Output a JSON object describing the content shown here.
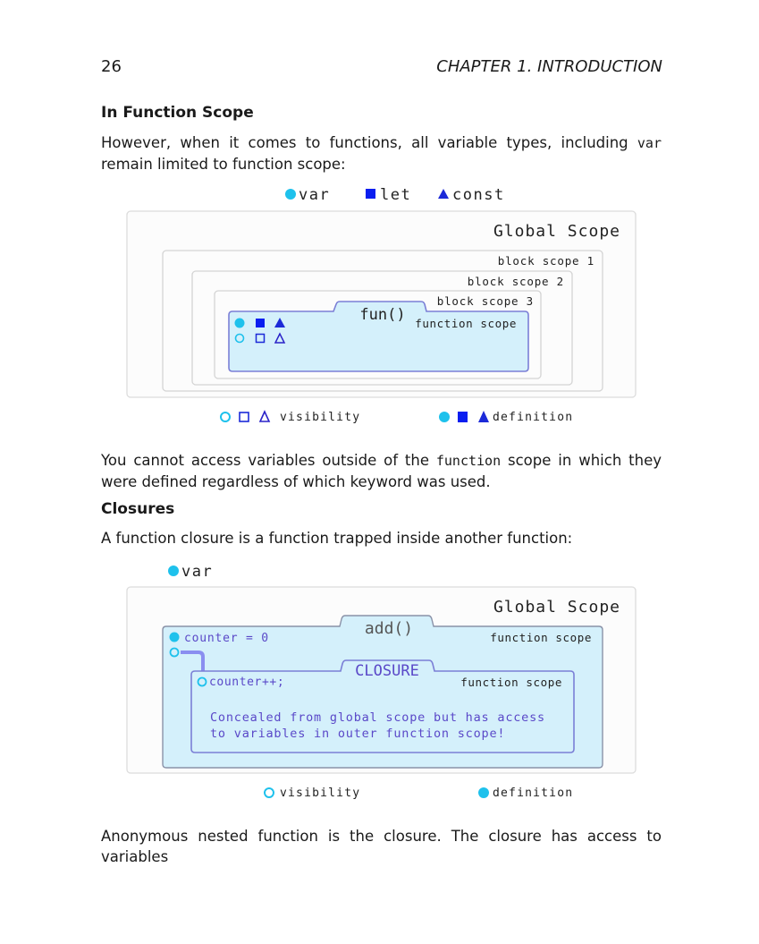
{
  "header": {
    "page_number": "26",
    "chapter": "CHAPTER 1.  INTRODUCTION"
  },
  "section1": {
    "title": "In Function Scope",
    "para_before": "However, when it comes to functions, all variable types, including ",
    "para_code": "var",
    "para_after": " remain limited to function scope:"
  },
  "diagram1": {
    "legend_top": [
      "var",
      "let",
      "const"
    ],
    "global_label": "Global Scope",
    "block1": "block scope 1",
    "block2": "block scope 2",
    "block3": "block scope 3",
    "fun_tab": "fun()",
    "fun_scope": "function scope",
    "legend_visibility": "visibility",
    "legend_definition": "definition"
  },
  "para2": {
    "before": "You cannot access variables outside of the ",
    "code": "function",
    "after": " scope in which they were defined regardless of which keyword was used."
  },
  "section2": {
    "title": "Closures",
    "para": "A function closure is a function trapped inside another function:"
  },
  "diagram2": {
    "legend_top": "var",
    "global_label": "Global Scope",
    "add_tab": "add()",
    "outer_scope": "function scope",
    "counter_def": "counter = 0",
    "closure_tab": "CLOSURE",
    "inner_scope": "function scope",
    "counter_inc": "counter++;",
    "note_line1": "Concealed from global scope but has access",
    "note_line2": "to variables in outer function scope!",
    "legend_visibility": "visibility",
    "legend_definition": "definition"
  },
  "para3": "Anonymous nested function is the closure.  The closure has access to variables",
  "colors": {
    "var": "#1ec1ec",
    "let": "#0a1ef0",
    "const": "#2a22c8",
    "function_fill": "#d4f0fb",
    "function_border": "#7b7fd6",
    "closure_text": "#5a48c8"
  }
}
